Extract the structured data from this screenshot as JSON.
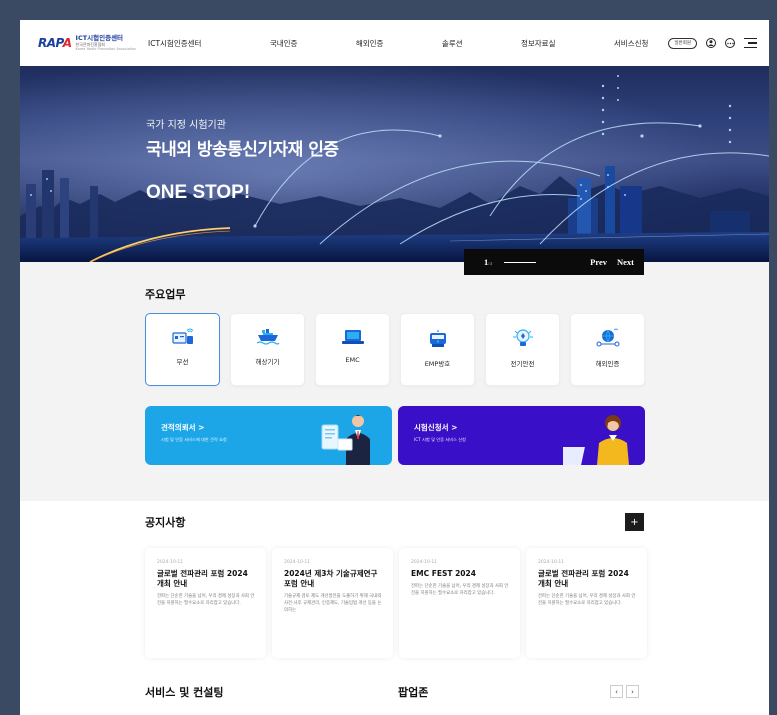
{
  "header": {
    "logo": {
      "mark": "RAPA",
      "name_ko": "ICT시험인증센터",
      "sub1": "한국전파진흥협회",
      "sub2": "Korea Radio Promotion Association"
    },
    "nav": [
      "ICT시험인증센터",
      "국내인증",
      "해외인증",
      "솔루션",
      "정보자료실",
      "서비스신청"
    ],
    "login_pill": "일반회원",
    "icons": [
      "user-icon",
      "more-icon",
      "menu-icon"
    ]
  },
  "hero": {
    "subtitle": "국가 지정 시험기관",
    "title": "국내외 방송통신기자재 인증",
    "headline": "ONE STOP!",
    "pager": {
      "current": "1",
      "total": "/3",
      "prev": "Prev",
      "next": "Next"
    }
  },
  "business": {
    "title": "주요업무",
    "cards": [
      {
        "label": "무선",
        "icon": "wireless-icon"
      },
      {
        "label": "해상기기",
        "icon": "ship-icon"
      },
      {
        "label": "EMC",
        "icon": "laptop-icon"
      },
      {
        "label": "EMP방호",
        "icon": "shield-device-icon"
      },
      {
        "label": "전기안전",
        "icon": "bulb-icon"
      },
      {
        "label": "해외인증",
        "icon": "globe-network-icon"
      }
    ],
    "banners": [
      {
        "title": "견적의뢰서  >",
        "desc": "시험 및 인증 서비스에 대한 견적 요청",
        "color": "#1ca6e8"
      },
      {
        "title": "시험신청서  >",
        "desc": "ICT 시험 및 인증 서비스 신청",
        "color": "#3a0fc8"
      }
    ]
  },
  "notices": {
    "title": "공지사항",
    "more": "+",
    "items": [
      {
        "date": "2024-10-11",
        "title": "글로벌 전파관리 포럼 2024 개최 안내",
        "body": "전파는 단순한 기술을 넘어, 우리 경제 성장과 사회 안전을 지원하는 필수요소로 자리잡고 있습니다."
      },
      {
        "date": "2024-10-11",
        "title": "2024년 제3차 기술규제연구 포럼 안내",
        "body": "기술규제 검토 제도 개선방안을 도출하기 위해 국내외 사전·사후 규제관리, 인증제도, 기술입법 개선 등을 논의하는"
      },
      {
        "date": "2024-10-11",
        "title": "EMC FEST 2024",
        "body": "전파는 단순한 기술을 넘어, 우리 경제 성장과 사회 안전을 지원하는 필수요소로 자리잡고 있습니다."
      },
      {
        "date": "2024-10-11",
        "title": "글로벌 전파관리 포럼 2024 개최 안내",
        "body": "전파는 단순한 기술을 넘어, 우리 경제 성장과 사회 안전을 지원하는 필수요소로 자리잡고 있습니다."
      }
    ]
  },
  "services": {
    "title": "서비스 및 컨설팅"
  },
  "popup": {
    "title": "팝업존",
    "prev": "‹",
    "next": "›"
  }
}
